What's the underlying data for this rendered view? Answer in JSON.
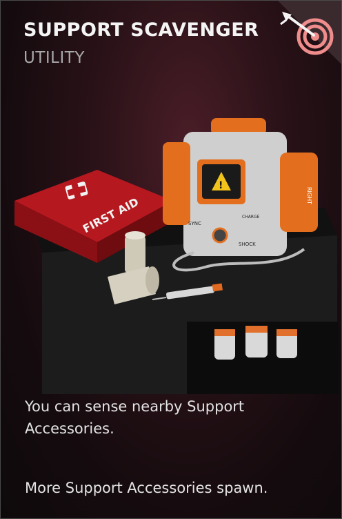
{
  "card": {
    "title": "SUPPORT SCAVENGER",
    "category": "UTILITY",
    "icon": "target-arrow-icon",
    "accent_color": "#ef8c8c",
    "description_1": "You can sense nearby Support Accessories.",
    "description_2": "More Support Accessories spawn."
  },
  "scene": {
    "first_aid_label": "FIRST AID",
    "defib_button_sync": "SYNC",
    "defib_button_charge": "CHARGE",
    "defib_button_shock": "SHOCK",
    "defib_side_label": "RIGHT"
  }
}
